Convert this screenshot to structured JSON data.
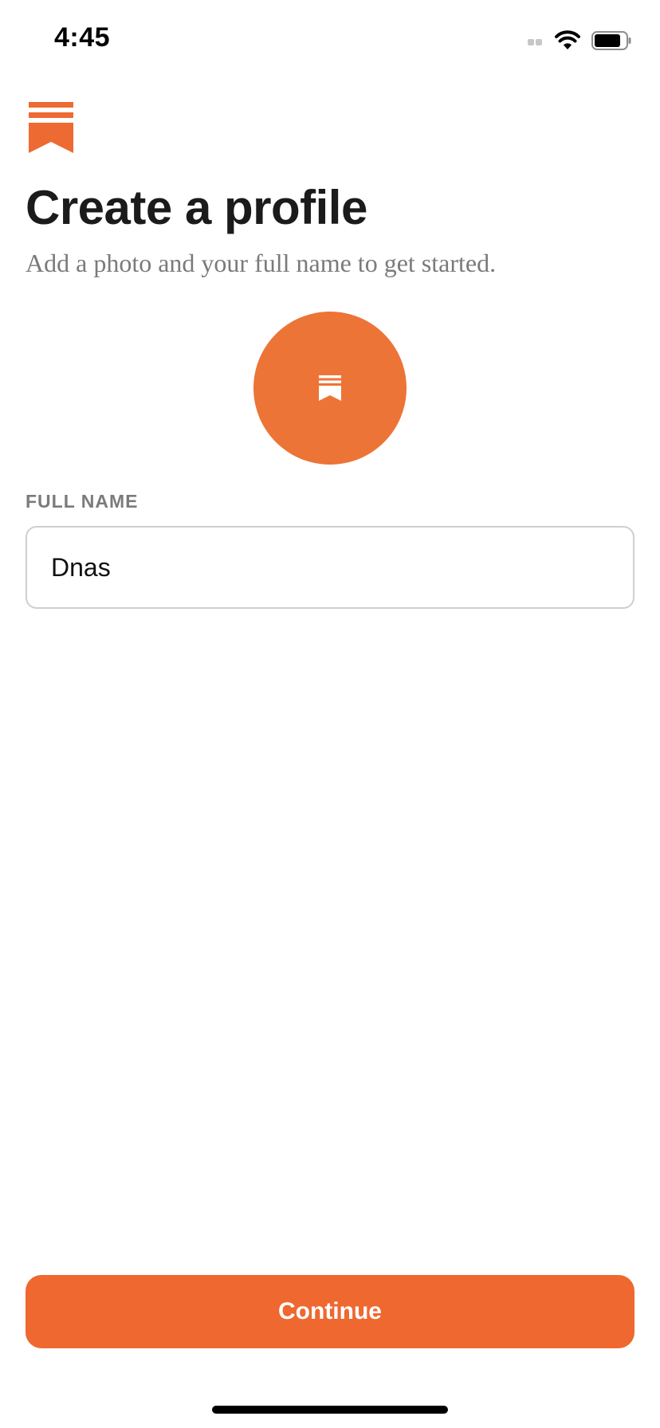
{
  "status_bar": {
    "time": "4:45",
    "icons": [
      "cellular-signal-icon",
      "wifi-icon",
      "battery-icon"
    ]
  },
  "brand": {
    "logo_icon": "bookmark-stack-logo-icon",
    "accent_color": "#ed6a32"
  },
  "header": {
    "title": "Create a profile",
    "subtitle": "Add a photo and your full name to get started."
  },
  "avatar": {
    "icon": "bookmark-stack-logo-icon",
    "color": "#ed7437"
  },
  "form": {
    "full_name_label": "FULL NAME",
    "full_name_value": "Dnas"
  },
  "actions": {
    "continue_label": "Continue",
    "continue_color": "#ee6830"
  }
}
